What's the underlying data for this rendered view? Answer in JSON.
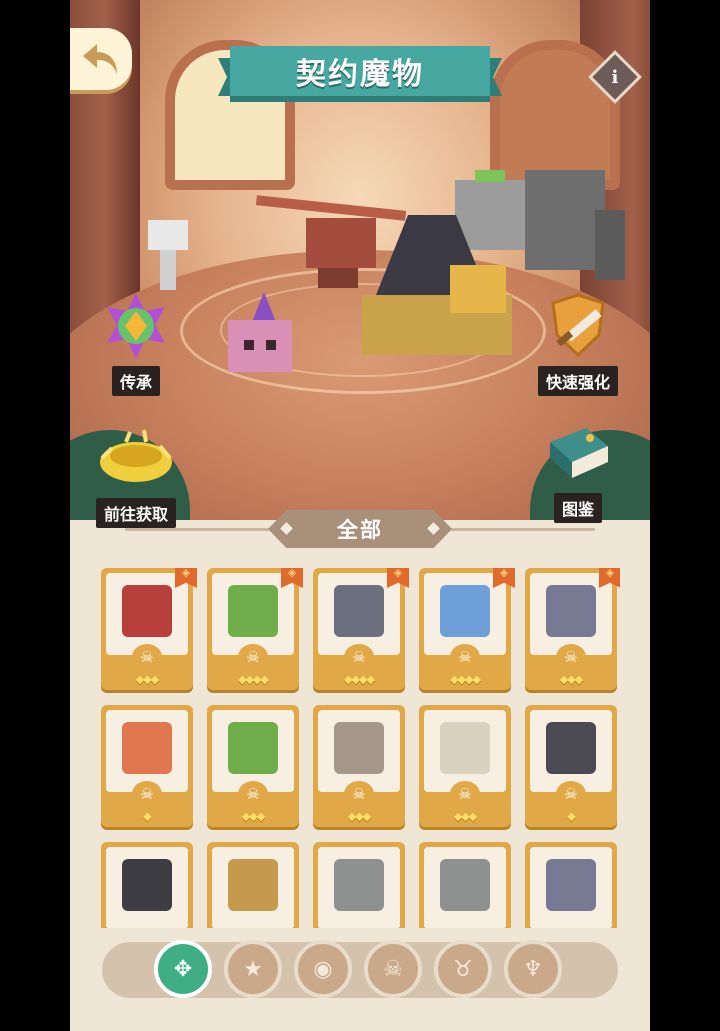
{
  "header": {
    "title": "契约魔物",
    "info_label": "i"
  },
  "actions": {
    "inherit": "传承",
    "quick_strengthen": "快速强化",
    "go_obtain": "前往获取",
    "codex": "图鉴"
  },
  "filter": {
    "current": "全部"
  },
  "monsters": [
    {
      "stars": 3,
      "cls": "☠",
      "color": "#b7403c",
      "tag": true
    },
    {
      "stars": 4,
      "cls": "☠",
      "color": "#6fae4a",
      "tag": true
    },
    {
      "stars": 4,
      "cls": "☠",
      "color": "#6c6f7e",
      "tag": true
    },
    {
      "stars": 4,
      "cls": "☠",
      "color": "#6f9fd8",
      "tag": true
    },
    {
      "stars": 3,
      "cls": "☠",
      "color": "#777a92",
      "tag": true
    },
    {
      "stars": 1,
      "cls": "☠",
      "color": "#e0774f",
      "tag": false
    },
    {
      "stars": 3,
      "cls": "☠",
      "color": "#6fae4a",
      "tag": false
    },
    {
      "stars": 3,
      "cls": "☠",
      "color": "#a5988a",
      "tag": false
    },
    {
      "stars": 3,
      "cls": "☠",
      "color": "#d9d2be",
      "tag": false
    },
    {
      "stars": 1,
      "cls": "☠",
      "color": "#4c4a52",
      "tag": false
    },
    {
      "stars": 0,
      "cls": "",
      "color": "#3f3d44",
      "tag": false
    },
    {
      "stars": 0,
      "cls": "",
      "color": "#c59a4c",
      "tag": false
    },
    {
      "stars": 0,
      "cls": "",
      "color": "#8f9190",
      "tag": false
    },
    {
      "stars": 0,
      "cls": "",
      "color": "#8f9190",
      "tag": false
    },
    {
      "stars": 0,
      "cls": "",
      "color": "#777a92",
      "tag": false
    }
  ],
  "tabs": [
    {
      "icon": "all-icon",
      "glyph": "✥",
      "active": true
    },
    {
      "icon": "star-class-icon",
      "glyph": "★",
      "active": false
    },
    {
      "icon": "beast-class-icon",
      "glyph": "◉",
      "active": false
    },
    {
      "icon": "skull-class-icon",
      "glyph": "☠",
      "active": false
    },
    {
      "icon": "horned-class-icon",
      "glyph": "♉",
      "active": false
    },
    {
      "icon": "demon-class-icon",
      "glyph": "♆",
      "active": false
    }
  ],
  "colors": {
    "accent": "#46a8a0",
    "card": "#e0a847",
    "active_tab": "#3fae84"
  }
}
